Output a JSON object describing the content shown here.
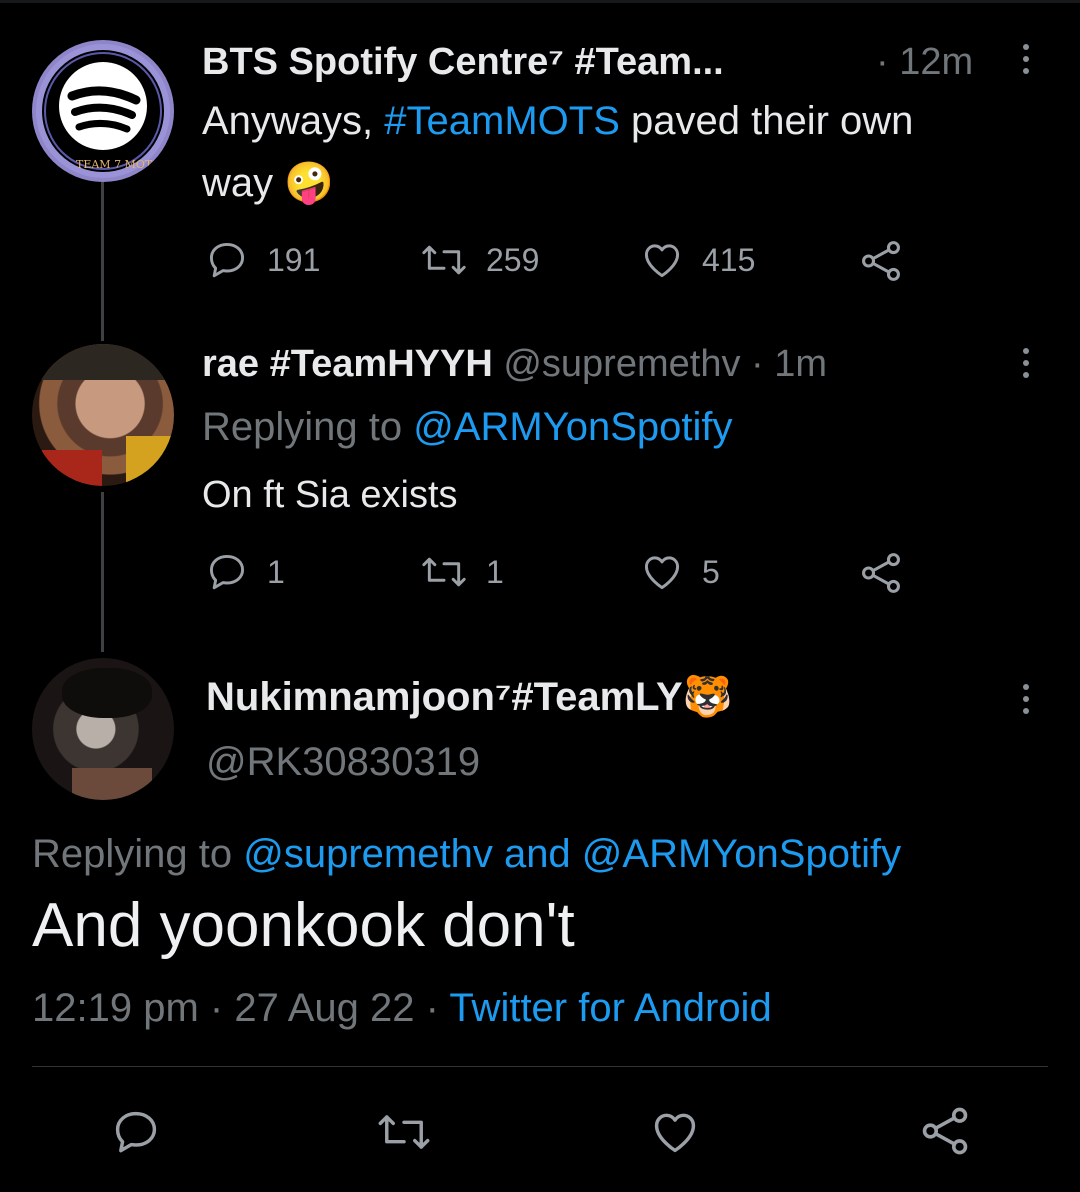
{
  "tweet1": {
    "display_name": "BTS Spotify Centre⁷ #Team...",
    "time": "· 12m",
    "text_prefix": "Anyways, ",
    "hashtag": "#TeamMOTS",
    "text_suffix": " paved their own",
    "text_line2": "way",
    "emoji": "🤪",
    "avatar_caption": "TEAM 7 MOTS",
    "replies": "191",
    "retweets": "259",
    "likes": "415"
  },
  "tweet2": {
    "display_name": "rae #TeamHYYH",
    "handle_time": "@supremethv · 1m",
    "replying_label": "Replying to ",
    "replying_to": "@ARMYonSpotify",
    "text": "On ft Sia exists",
    "replies": "1",
    "retweets": "1",
    "likes": "5"
  },
  "main_tweet": {
    "display_name": "Nukimnamjoon⁷#TeamLY",
    "name_emoji": "🐯",
    "handle": "@RK30830319",
    "replying_label": "Replying to ",
    "replying_to_1": "@supremethv",
    "replying_and": " and ",
    "replying_to_2": "@ARMYonSpotify",
    "text": "And yoonkook don't",
    "timestamp": "12:19 pm · 27 Aug 22 · ",
    "source": "Twitter for Android"
  },
  "colors": {
    "background": "#000000",
    "link": "#1d9bf0",
    "text": "#e7e9ea",
    "muted": "#71767b"
  }
}
